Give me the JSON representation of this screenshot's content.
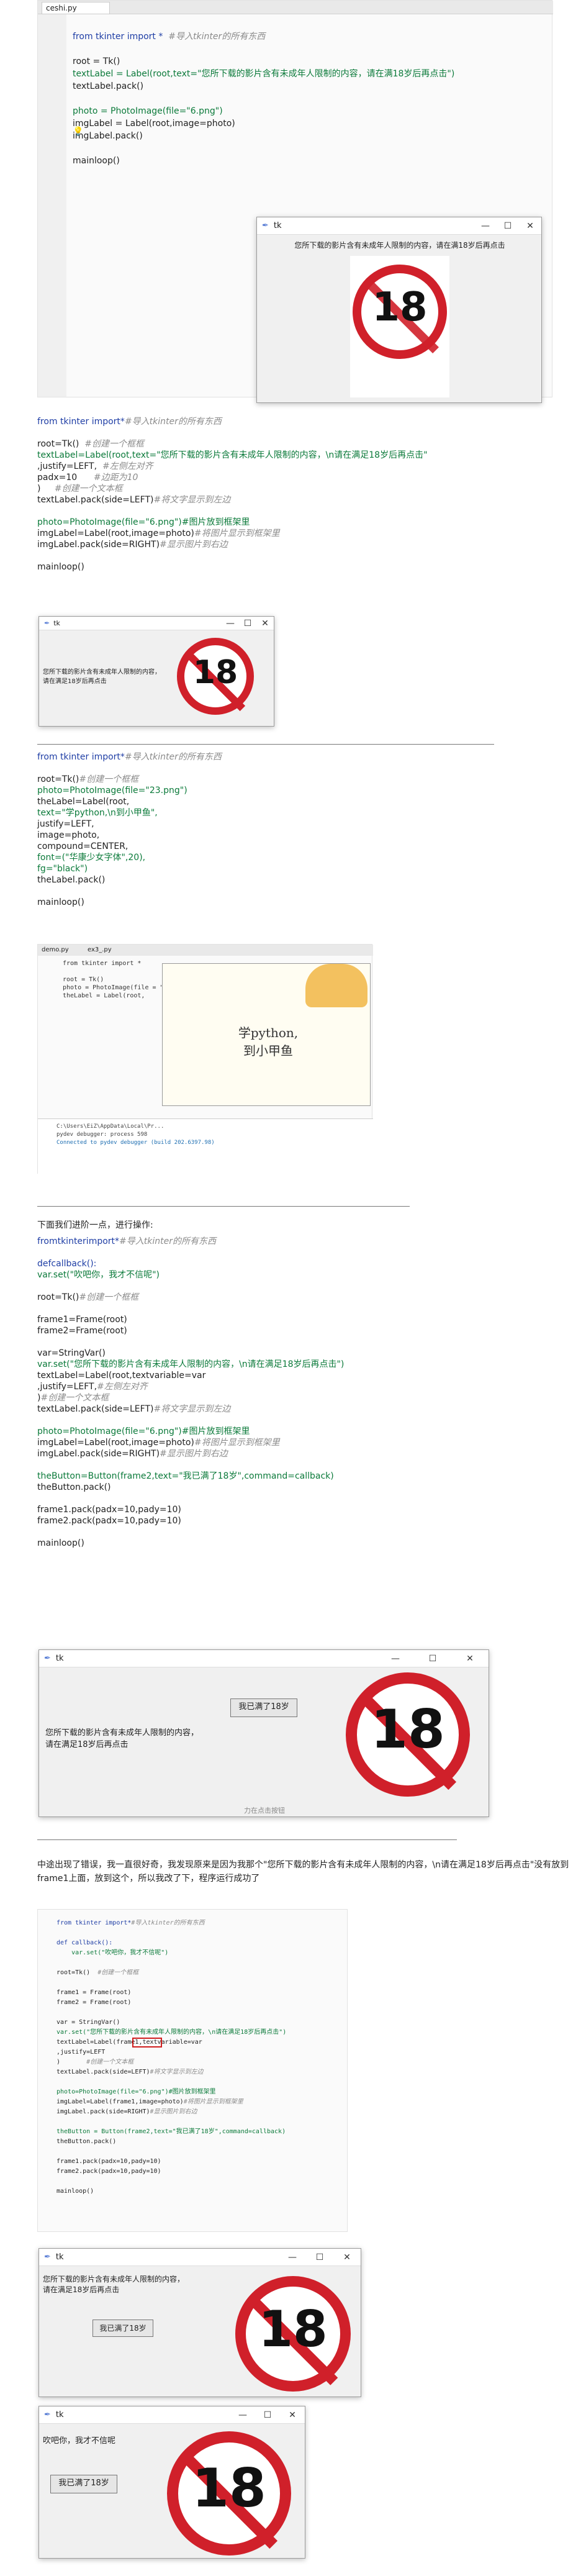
{
  "ide1": {
    "tab": "ceshi.py",
    "lines": [
      "from tkinter import *  #导入tkinter的所有东西",
      "",
      "root = Tk()",
      "textLabel = Label(root,text=\"您所下载的影片含有未成年人限制的内容，请在满18岁后再点击\")",
      "textLabel.pack()",
      "",
      "photo = PhotoImage(file=\"6.png\")",
      "imgLabel = Label(root,image=photo)",
      "imgLabel.pack()",
      "",
      "mainloop()"
    ],
    "window": {
      "title": "tk",
      "text": "您所下载的影片含有未成年人限制的内容，请在满18岁后再点击",
      "sign": "18"
    }
  },
  "code2": [
    "from tkinter import*#导入tkinter的所有东西",
    "",
    "root=Tk()  #创建一个框框",
    "textLabel=Label(root,text=\"您所下载的影片含有未成年人限制的内容，\\n请在满足18岁后再点击\"",
    ",justify=LEFT,  #左侧左对齐",
    "padx=10      #边距为10",
    ")     #创建一个文本框",
    "textLabel.pack(side=LEFT)#将文字显示到左边",
    "",
    "photo=PhotoImage(file=\"6.png\")#图片放到框架里",
    "imgLabel=Label(root,image=photo)#将图片显示到框架里",
    "imgLabel.pack(side=RIGHT)#显示图片到右边",
    "",
    "mainloop()"
  ],
  "win2": {
    "title": "tk",
    "text": "您所下载的影片含有未成年人限制的内容，\n请在满足18岁后再点击",
    "sign": "18"
  },
  "code3": [
    "from tkinter import*#导入tkinter的所有东西",
    "",
    "root=Tk()#创建一个框框",
    "photo=PhotoImage(file=\"23.png\")",
    "theLabel=Label(root,",
    "text=\"学python,\\n到小甲鱼\",",
    "justify=LEFT,",
    "image=photo,",
    "compound=CENTER,",
    "font=(\"华康少女字体\",20),",
    "fg=\"black\")",
    "theLabel.pack()",
    "",
    "mainloop()"
  ],
  "ide3": {
    "tabs": [
      "demo.py",
      "ex3_.py"
    ],
    "bg_text": "学python,\n到小甲鱼",
    "console_lines": [
      "C:\\Users\\EiZ\\AppData\\Local\\Pr...",
      "pydev debugger: process 598",
      "",
      "Connected to pydev debugger (build 202.6397.98)"
    ]
  },
  "text4": "下面我们进阶一点，进行操作:",
  "code4": [
    "fromtkinterimport*#导入tkinter的所有东西",
    "",
    "defcallback():",
    "var.set(\"吹吧你，我才不信呢\")",
    "",
    "root=Tk()#创建一个框框",
    "",
    "frame1=Frame(root)",
    "frame2=Frame(root)",
    "",
    "var=StringVar()",
    "var.set(\"您所下载的影片含有未成年人限制的内容，\\n请在满足18岁后再点击\")",
    "textLabel=Label(root,textvariable=var",
    ",justify=LEFT,#左侧左对齐",
    ")#创建一个文本框",
    "textLabel.pack(side=LEFT)#将文字显示到左边",
    "",
    "photo=PhotoImage(file=\"6.png\")#图片放到框架里",
    "imgLabel=Label(root,image=photo)#将图片显示到框架里",
    "imgLabel.pack(side=RIGHT)#显示图片到右边",
    "",
    "theButton=Button(frame2,text=\"我已满了18岁\",command=callback)",
    "theButton.pack()",
    "",
    "frame1.pack(padx=10,pady=10)",
    "frame2.pack(padx=10,pady=10)",
    "",
    "mainloop()"
  ],
  "win4": {
    "title": "tk",
    "button": "我已满了18岁",
    "text": "您所下载的影片含有未成年人限制的内容，\n请在满足18岁后再点击",
    "sign": "18",
    "footer": "力在点击按钮"
  },
  "text5": "中途出现了错误，我一直很好奇，我发现原来是因为我那个\"您所下载的影片含有未成年人限制的内容，\\n请在满足18岁后再点击\"没有放到frame1上面，放到这个，所以我改了下，程序运行成功了",
  "ide5": {
    "lines": [
      "from tkinter import*#导入tkinter的所有东西",
      "",
      "def callback():",
      "    var.set(\"吹吧你，我才不信呢\")",
      "",
      "root=Tk()  #创建一个框框",
      "",
      "frame1 = Frame(root)",
      "frame2 = Frame(root)",
      "",
      "var = StringVar()",
      "var.set(\"您所下载的影片含有未成年人限制的内容，\\n请在满足18岁后再点击\")",
      "textLabel=Label(frame1,textvariable=var",
      ",justify=LEFT",
      ")       #创建一个文本框",
      "textLabel.pack(side=LEFT)#将文字显示到左边",
      "",
      "photo=PhotoImage(file=\"6.png\")#图片放到框架里",
      "imgLabel=Label(frame1,image=photo)#将图片显示到框架里",
      "imgLabel.pack(side=RIGHT)#显示图片到右边",
      "",
      "theButton = Button(frame2,text=\"我已满了18岁\",command=callback)",
      "theButton.pack()",
      "",
      "frame1.pack(padx=10,pady=10)",
      "frame2.pack(padx=10,pady=10)",
      "",
      "mainloop()"
    ]
  },
  "win5": {
    "title": "tk",
    "text": "您所下载的影片含有未成年人限制的内容，\n请在满足18岁后再点击",
    "button": "我已满了18岁",
    "sign": "18"
  },
  "win6": {
    "title": "tk",
    "text": "吹吧你，我才不信呢",
    "button": "我已满了18岁",
    "sign": "18"
  },
  "colors": {
    "keyword": "#1f3ea5",
    "comment": "#8b8b8b",
    "string": "#067d17",
    "sign_red": "#d0202a"
  }
}
